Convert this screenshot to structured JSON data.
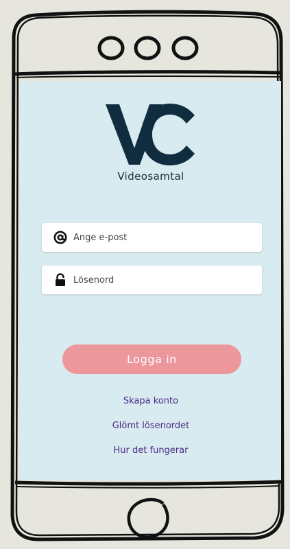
{
  "logo": {
    "mark": "VC",
    "subtitle": "Videosamtal",
    "color": "#0f2d3f"
  },
  "form": {
    "email_placeholder": "Ange e-post",
    "password_placeholder": "Lösenord",
    "email_icon": "at-sign-icon",
    "password_icon": "lock-icon"
  },
  "actions": {
    "login_label": "Logga in",
    "login_color": "#ec979b"
  },
  "links": {
    "create_account": "Skapa konto",
    "forgot_password": "Glömt lösenordet",
    "how_it_works": "Hur det fungerar",
    "color": "#4b2a86"
  },
  "theme": {
    "screen_background": "#d8ebf0",
    "device_outline": "#111111",
    "device_fill": "#e6e6de"
  }
}
